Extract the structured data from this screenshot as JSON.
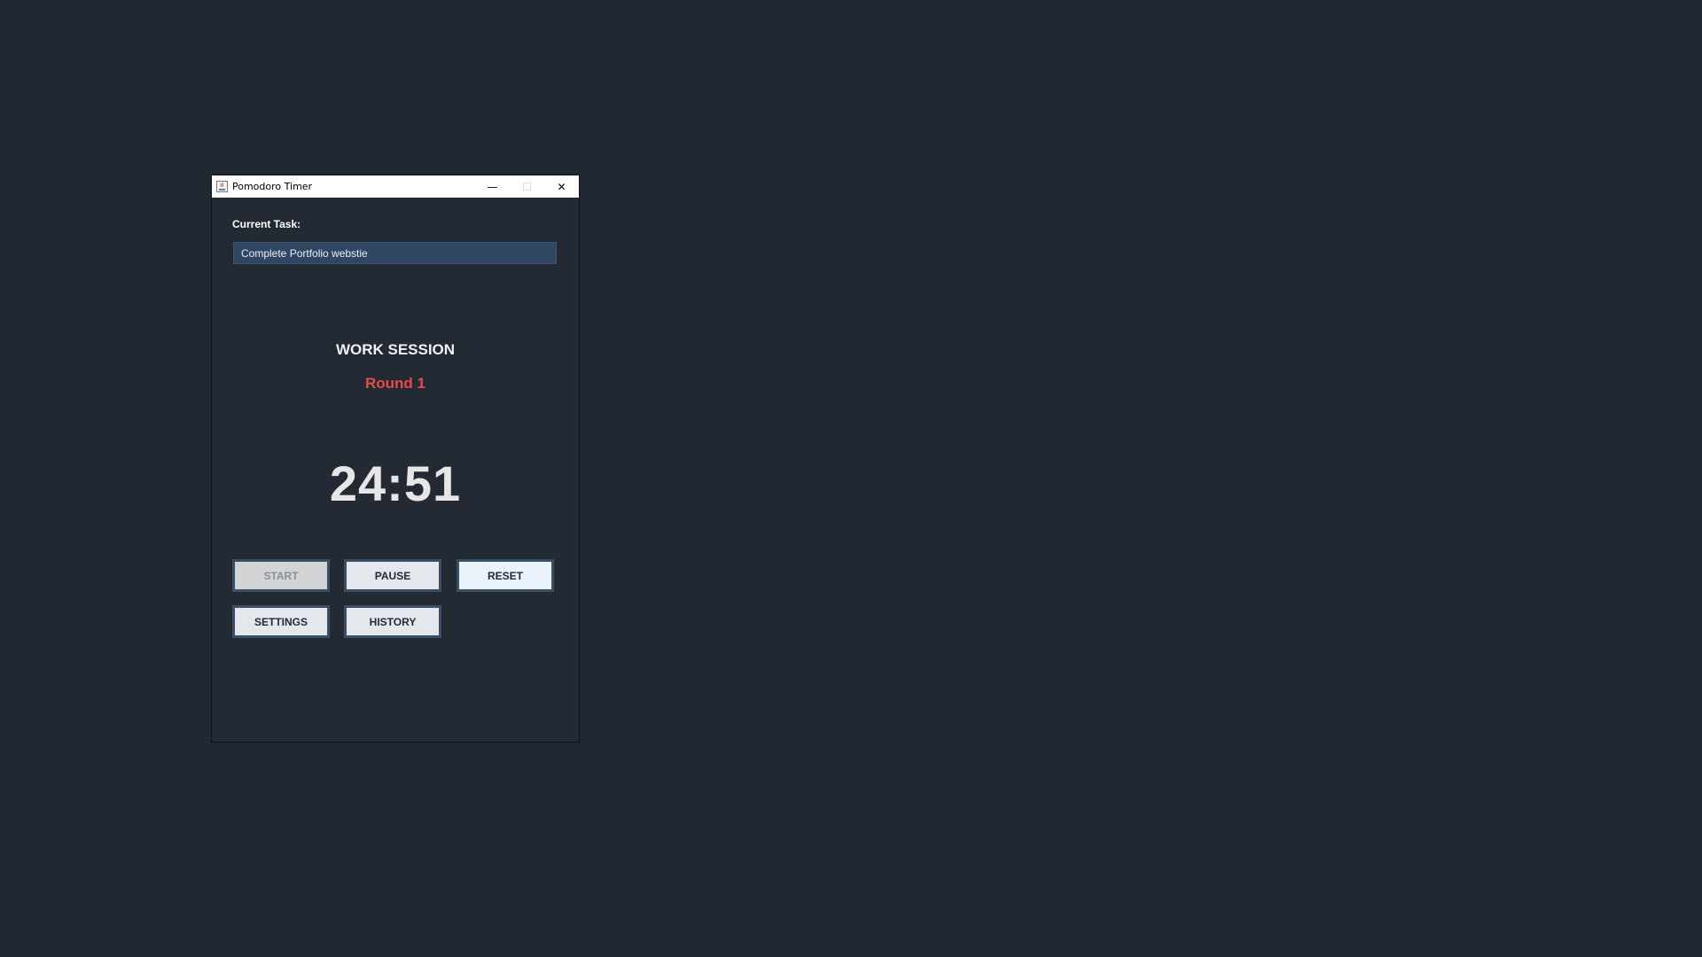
{
  "window": {
    "title": "Pomodoro Timer",
    "controls": {
      "minimize": "—",
      "maximize": "☐",
      "close": "✕"
    }
  },
  "task": {
    "label": "Current Task:",
    "value": "Complete Portfolio webstie"
  },
  "session": {
    "type": "WORK SESSION",
    "round": "Round 1"
  },
  "timer": {
    "display": "24:51"
  },
  "buttons": {
    "start": "START",
    "pause": "PAUSE",
    "reset": "RESET",
    "settings": "SETTINGS",
    "history": "HISTORY"
  },
  "colors": {
    "desktop": "#222831",
    "window_bg": "#232a34",
    "round_accent": "#e84a4a",
    "input_bg": "#2f4763"
  }
}
